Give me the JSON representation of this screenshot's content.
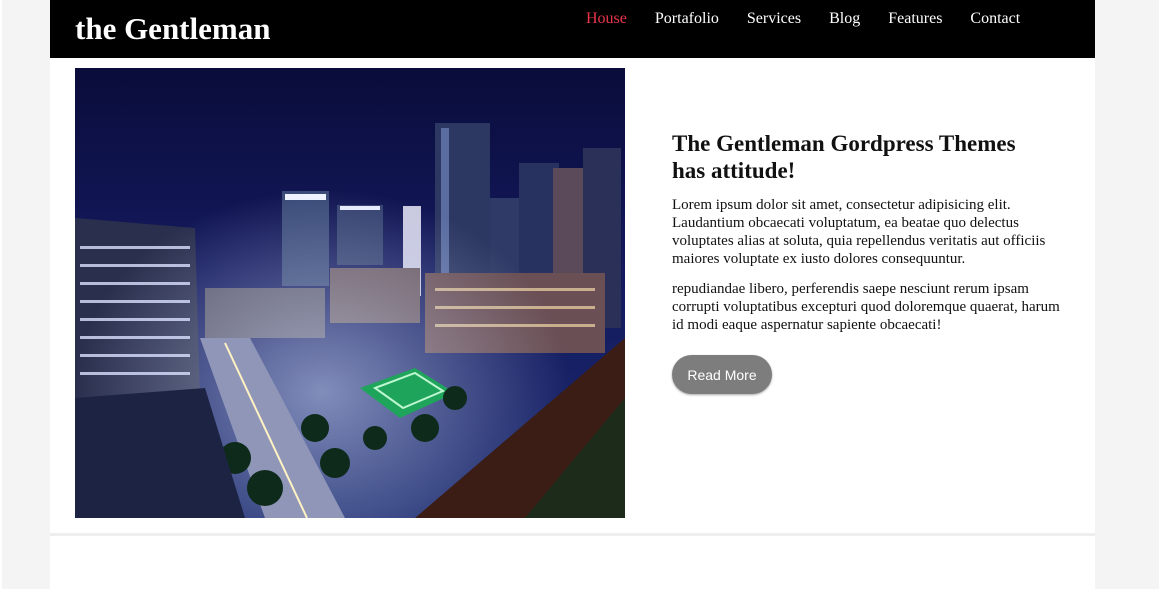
{
  "header": {
    "brand": "the Gentleman",
    "nav": [
      {
        "label": "House",
        "active": true
      },
      {
        "label": "Portafolio",
        "active": false
      },
      {
        "label": "Services",
        "active": false
      },
      {
        "label": "Blog",
        "active": false
      },
      {
        "label": "Features",
        "active": false
      },
      {
        "label": "Contact",
        "active": false
      }
    ]
  },
  "hero": {
    "image_subject": "night-city-skyline",
    "heading": "The Gentleman Gordpress Themes has attitude!",
    "paragraphs": [
      "Lorem ipsum dolor sit amet, consectetur adipisicing elit. Laudantium obcaecati voluptatum, ea beatae quo delectus voluptates alias at soluta, quia repellendus veritatis aut officiis maiores voluptate ex iusto dolores consequuntur.",
      "repudiandae libero, perferendis saepe nesciunt rerum ipsam corrupti voluptatibus excepturi quod doloremque quaerat, harum id modi eaque aspernatur sapiente obcaecati!"
    ],
    "button_label": "Read More"
  },
  "colors": {
    "header_bg": "#000000",
    "nav_active": "#e8354a",
    "button_bg": "#7d7d7d",
    "page_bg": "#f4f4f4"
  }
}
